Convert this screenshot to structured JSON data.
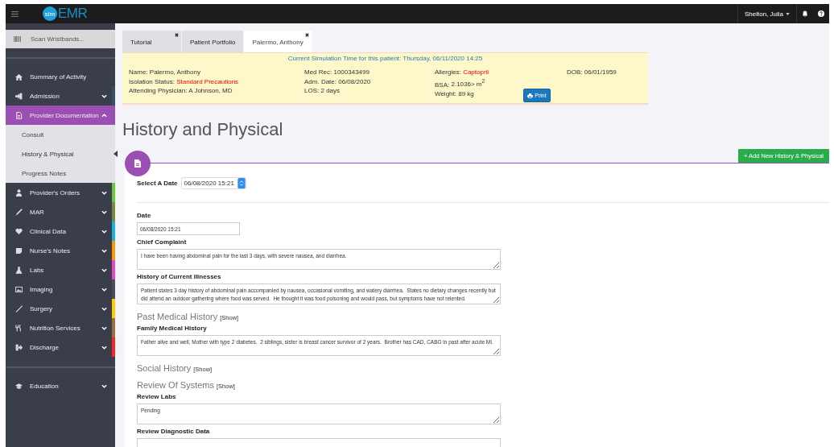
{
  "topbar": {
    "logo_badge": "sim",
    "logo_text": "EMR",
    "user": "Shelton, Julia"
  },
  "sidebar": {
    "scan_placeholder": "Scan Wristbands...",
    "items": [
      {
        "label": "Summary of Activity",
        "expandable": false,
        "selected": false
      },
      {
        "label": "Admission",
        "expandable": true,
        "expanded": false,
        "selected": false,
        "color": "#34506e"
      },
      {
        "label": "Provider Documentation",
        "expandable": true,
        "expanded": true,
        "selected": true,
        "children": [
          {
            "label": "Consult",
            "selected": false
          },
          {
            "label": "History & Physical",
            "selected": true
          },
          {
            "label": "Progress Notes",
            "selected": false
          }
        ]
      },
      {
        "label": "Provider's Orders",
        "expandable": true,
        "expanded": false,
        "selected": false,
        "color": "#66cc33"
      },
      {
        "label": "MAR",
        "expandable": true,
        "expanded": false,
        "selected": false,
        "color": "#7a8a3a"
      },
      {
        "label": "Clinical Data",
        "expandable": true,
        "expanded": false,
        "selected": false,
        "color": "#1ab4e4"
      },
      {
        "label": "Nurse's Notes",
        "expandable": true,
        "expanded": false,
        "selected": false,
        "color": "#ff9900"
      },
      {
        "label": "Labs",
        "expandable": true,
        "expanded": false,
        "selected": false,
        "color": "#e844d4"
      },
      {
        "label": "Imaging",
        "expandable": true,
        "expanded": false,
        "selected": false,
        "color": "#4a4d52"
      },
      {
        "label": "Surgery",
        "expandable": true,
        "expanded": false,
        "selected": false,
        "color": "#ffcc00"
      },
      {
        "label": "Nutrition Services",
        "expandable": true,
        "expanded": false,
        "selected": false,
        "color": "#a0703c"
      },
      {
        "label": "Discharge",
        "expandable": true,
        "expanded": false,
        "selected": false,
        "color": "#ff2222"
      }
    ],
    "footer_items": [
      {
        "label": "Education",
        "expandable": true,
        "expanded": false,
        "selected": false
      }
    ]
  },
  "tabs": [
    {
      "label": "Tutorial",
      "closable": true,
      "selected": false
    },
    {
      "label": "Patient Portfolio",
      "closable": false,
      "selected": false
    },
    {
      "label": "Palermo, Anthony",
      "closable": true,
      "selected": true
    }
  ],
  "banner": {
    "simulation_time": "Current Simulation Time for this patient: Thursday, 06/11/2020 14:25",
    "columns": [
      [
        {
          "label": "Name:",
          "value": "Palermo, Anthony",
          "alert": false
        },
        {
          "label": "Isolation Status:",
          "value": "Standard Precautions",
          "alert": true
        },
        {
          "label": "Attending Physician:",
          "value": "A Johnson, MD",
          "alert": false
        }
      ],
      [
        {
          "label": "Med Rec:",
          "value": "1000343499",
          "alert": false
        },
        {
          "label": "Adm. Date:",
          "value": "06/08/2020",
          "alert": false
        },
        {
          "label": "LOS:",
          "value": "2 days",
          "alert": false
        }
      ],
      [
        {
          "label": "Allergies:",
          "value": "Captopril",
          "alert": true
        },
        {
          "label": "BSA:",
          "value": "2.1036> m$^{2}$",
          "alert": false
        },
        {
          "label": "Weight:",
          "value": "89 kg",
          "alert": false
        }
      ],
      [
        {
          "label": "DOB:",
          "value": "06/01/1959",
          "alert": false
        }
      ]
    ],
    "print_button": "Print"
  },
  "page": {
    "title": "History and Physical",
    "add_button": "+ Add New History & Physical"
  },
  "form": {
    "date_select": {
      "label": "Select A Date",
      "value": "06/08/2020 15:21"
    },
    "fields": [
      {
        "kind": "input",
        "label": "Date",
        "value": "06/08/2020 15:21"
      },
      {
        "kind": "textarea",
        "label": "Chief Complaint",
        "value": "I have been having abdominal pain for the last 3 days, with severe nausea, and diarrhea."
      },
      {
        "kind": "textarea",
        "label": "History of Current Illnesses",
        "value": "Patient states 3 day history of abdominal pain accompanied by nausea, occasional vomiting, and watery diarrhea.  States no dietary changes recently but did attend an outdoor gathering where food was served.  He thought it was food poisoning and would pass, but symptoms have not relented."
      },
      {
        "kind": "section",
        "label": "Past Medical History",
        "toggle": "[Show]"
      },
      {
        "kind": "textarea",
        "label": "Family Medical History",
        "value": "Father alive and well, Mother with type 2 diabetes.  2 siblings, sister is breast cancer survivor of 2 years.  Brother has CAD, CABG in past after acute MI."
      },
      {
        "kind": "section",
        "label": "Social History",
        "toggle": "[Show]"
      },
      {
        "kind": "section",
        "label": "Review Of Systems",
        "toggle": "[Show]"
      },
      {
        "kind": "textarea",
        "label": "Review Labs",
        "value": "Pending"
      },
      {
        "kind": "textarea",
        "label": "Review Diagnostic Data"
      }
    ]
  }
}
